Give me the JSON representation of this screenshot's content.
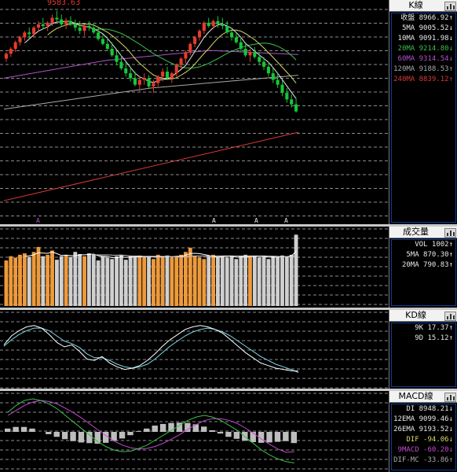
{
  "colors": {
    "up": "#e63b2e",
    "down": "#17c63a",
    "ma5": "#e8e8e8",
    "ma10": "#d8d86a",
    "ma20": "#3bbf4c",
    "ma60": "#b153c8",
    "ma120": "#a9a9a9",
    "ma240": "#d43a3a",
    "vol_up": "#ee9a3c",
    "vol_down": "#d0d0d0",
    "k": "#ffffff",
    "d": "#80d8e8",
    "grid": "#8c8c8c",
    "panel_bg": "#000000"
  },
  "kline": {
    "title": "K線",
    "high_label": "9583.63",
    "rows": [
      {
        "label": "收盤",
        "value": "8966.92",
        "arrow": "↑",
        "color": "#e8e8e8"
      },
      {
        "label": "5MA",
        "value": "9005.52",
        "arrow": "↓",
        "color": "#e8e8e8"
      },
      {
        "label": "10MA",
        "value": "9091.98",
        "arrow": "↓",
        "color": "#e8e8e8"
      },
      {
        "label": "20MA",
        "value": "9214.80",
        "arrow": "↓",
        "color": "#3bbf4c"
      },
      {
        "label": "60MA",
        "value": "9314.54",
        "arrow": "↓",
        "color": "#b153c8"
      },
      {
        "label": "120MA",
        "value": "9188.53",
        "arrow": "↑",
        "color": "#a9a9a9"
      },
      {
        "label": "240MA",
        "value": "8839.12",
        "arrow": "↑",
        "color": "#d43a3a"
      }
    ],
    "markers": [
      "A",
      "A",
      "A",
      "A"
    ]
  },
  "volume": {
    "title": "成交量",
    "rows": [
      {
        "label": "VOL",
        "value": "1002",
        "arrow": "↑",
        "color": "#e8e8e8"
      },
      {
        "label": "5MA",
        "value": "870.30",
        "arrow": "↑",
        "color": "#e8e8e8"
      },
      {
        "label": "20MA",
        "value": "790.83",
        "arrow": "↑",
        "color": "#e8e8e8"
      }
    ]
  },
  "kd": {
    "title": "KD線",
    "rows": [
      {
        "label": "9K",
        "value": "17.37",
        "arrow": "↑",
        "color": "#e8e8e8"
      },
      {
        "label": "9D",
        "value": "15.12",
        "arrow": "↑",
        "color": "#e8e8e8"
      }
    ]
  },
  "macd": {
    "title": "MACD線",
    "rows": [
      {
        "label": "DI",
        "value": "8948.21",
        "arrow": "↓",
        "color": "#e8e8e8"
      },
      {
        "label": "12EMA",
        "value": "9099.46",
        "arrow": "↓",
        "color": "#e8e8e8"
      },
      {
        "label": "26EMA",
        "value": "9193.52",
        "arrow": "↓",
        "color": "#e8e8e8"
      },
      {
        "label": "DIF",
        "value": "-94.06",
        "arrow": "↓",
        "color": "#d8d86a"
      },
      {
        "label": "9MACD",
        "value": "-60.20",
        "arrow": "↓",
        "color": "#c24ad2"
      },
      {
        "label": "DIF-MC",
        "value": "-33.86",
        "arrow": "↑",
        "color": "#a9a9a9"
      }
    ]
  },
  "chart_data": [
    {
      "type": "candlestick",
      "title": "K線",
      "candles": [
        [
          9290,
          9330,
          9270,
          9320
        ],
        [
          9320,
          9360,
          9300,
          9350
        ],
        [
          9350,
          9400,
          9330,
          9390
        ],
        [
          9390,
          9430,
          9370,
          9420
        ],
        [
          9420,
          9460,
          9400,
          9450
        ],
        [
          9450,
          9480,
          9410,
          9440
        ],
        [
          9440,
          9490,
          9420,
          9480
        ],
        [
          9480,
          9520,
          9460,
          9500
        ],
        [
          9500,
          9540,
          9470,
          9490
        ],
        [
          9490,
          9520,
          9460,
          9510
        ],
        [
          9510,
          9560,
          9490,
          9540
        ],
        [
          9540,
          9583.63,
          9510,
          9530
        ],
        [
          9530,
          9560,
          9490,
          9500
        ],
        [
          9500,
          9540,
          9470,
          9520
        ],
        [
          9520,
          9550,
          9490,
          9500
        ],
        [
          9500,
          9530,
          9460,
          9480
        ],
        [
          9480,
          9520,
          9440,
          9460
        ],
        [
          9460,
          9500,
          9430,
          9490
        ],
        [
          9490,
          9520,
          9460,
          9480
        ],
        [
          9480,
          9510,
          9440,
          9450
        ],
        [
          9450,
          9480,
          9400,
          9410
        ],
        [
          9410,
          9440,
          9370,
          9380
        ],
        [
          9380,
          9420,
          9340,
          9350
        ],
        [
          9350,
          9390,
          9300,
          9310
        ],
        [
          9310,
          9340,
          9250,
          9270
        ],
        [
          9270,
          9310,
          9220,
          9230
        ],
        [
          9230,
          9270,
          9180,
          9200
        ],
        [
          9200,
          9240,
          9150,
          9170
        ],
        [
          9170,
          9210,
          9120,
          9130
        ],
        [
          9130,
          9180,
          9090,
          9160
        ],
        [
          9160,
          9200,
          9130,
          9170
        ],
        [
          9170,
          9190,
          9110,
          9120
        ],
        [
          9120,
          9160,
          9080,
          9140
        ],
        [
          9140,
          9190,
          9120,
          9180
        ],
        [
          9180,
          9230,
          9150,
          9210
        ],
        [
          9210,
          9240,
          9160,
          9170
        ],
        [
          9170,
          9210,
          9140,
          9200
        ],
        [
          9200,
          9260,
          9180,
          9250
        ],
        [
          9250,
          9300,
          9230,
          9290
        ],
        [
          9290,
          9340,
          9260,
          9330
        ],
        [
          9330,
          9390,
          9310,
          9380
        ],
        [
          9380,
          9430,
          9360,
          9420
        ],
        [
          9420,
          9470,
          9400,
          9460
        ],
        [
          9460,
          9520,
          9440,
          9510
        ],
        [
          9510,
          9540,
          9480,
          9490
        ],
        [
          9490,
          9530,
          9470,
          9520
        ],
        [
          9520,
          9550,
          9480,
          9500
        ],
        [
          9500,
          9540,
          9470,
          9490
        ],
        [
          9490,
          9520,
          9440,
          9450
        ],
        [
          9450,
          9480,
          9400,
          9420
        ],
        [
          9420,
          9450,
          9380,
          9390
        ],
        [
          9390,
          9420,
          9330,
          9350
        ],
        [
          9350,
          9380,
          9300,
          9310
        ],
        [
          9310,
          9350,
          9270,
          9330
        ],
        [
          9330,
          9360,
          9290,
          9300
        ],
        [
          9300,
          9330,
          9250,
          9270
        ],
        [
          9270,
          9300,
          9220,
          9240
        ],
        [
          9240,
          9270,
          9180,
          9200
        ],
        [
          9200,
          9230,
          9140,
          9160
        ],
        [
          9160,
          9200,
          9110,
          9130
        ],
        [
          9130,
          9160,
          9060,
          9080
        ],
        [
          9080,
          9110,
          9020,
          9040
        ],
        [
          9040,
          9070,
          8990,
          9010
        ],
        [
          9010,
          9050,
          8960,
          8966.92
        ]
      ]
    },
    {
      "type": "bar",
      "title": "成交量",
      "values": [
        640,
        700,
        680,
        720,
        740,
        690,
        760,
        830,
        700,
        720,
        780,
        650,
        700,
        720,
        690,
        760,
        730,
        700,
        740,
        720,
        640,
        700,
        680,
        660,
        700,
        720,
        650,
        700,
        690,
        710,
        680,
        700,
        660,
        720,
        690,
        710,
        680,
        700,
        720,
        760,
        820,
        700,
        680,
        660,
        700,
        720,
        690,
        700,
        680,
        700,
        660,
        700,
        720,
        690,
        700,
        680,
        700,
        660,
        700,
        690,
        710,
        700,
        720,
        1002
      ]
    },
    {
      "type": "line",
      "title": "KD線",
      "series": [
        {
          "name": "9K",
          "values": [
            58,
            72,
            80,
            86,
            88,
            84,
            74,
            62,
            55,
            58,
            48,
            36,
            34,
            40,
            30,
            24,
            20,
            22,
            26,
            34,
            44,
            56,
            66,
            74,
            82,
            86,
            88,
            86,
            82,
            76,
            66,
            56,
            46,
            38,
            30,
            26,
            22,
            20,
            18,
            17.37
          ]
        },
        {
          "name": "9D",
          "values": [
            56,
            66,
            74,
            80,
            84,
            84,
            80,
            72,
            64,
            60,
            54,
            44,
            38,
            38,
            34,
            28,
            24,
            22,
            24,
            28,
            36,
            46,
            56,
            64,
            72,
            78,
            82,
            84,
            82,
            78,
            72,
            64,
            56,
            48,
            40,
            34,
            28,
            24,
            20,
            15.12
          ]
        }
      ]
    },
    {
      "type": "bar",
      "title": "MACD線",
      "series": [
        {
          "name": "DIF",
          "values": [
            60,
            80,
            95,
            100,
            95,
            85,
            70,
            50,
            30,
            10,
            -10,
            -30,
            -45,
            -55,
            -60,
            -58,
            -50,
            -40,
            -25,
            -10,
            5,
            20,
            35,
            45,
            50,
            45,
            35,
            20,
            5,
            -15,
            -35,
            -55,
            -70,
            -82,
            -90,
            -94.06
          ]
        },
        {
          "name": "9MACD",
          "values": [
            50,
            65,
            80,
            90,
            95,
            92,
            85,
            72,
            58,
            42,
            24,
            6,
            -12,
            -28,
            -40,
            -48,
            -52,
            -50,
            -44,
            -34,
            -22,
            -8,
            8,
            22,
            34,
            40,
            40,
            35,
            26,
            12,
            -4,
            -22,
            -38,
            -52,
            -62,
            -60.2
          ]
        },
        {
          "name": "DIF-MC",
          "values": [
            10,
            15,
            15,
            10,
            0,
            -7,
            -15,
            -22,
            -28,
            -32,
            -34,
            -36,
            -33,
            -27,
            -20,
            -10,
            2,
            10,
            19,
            24,
            27,
            28,
            27,
            23,
            16,
            5,
            -5,
            -15,
            -21,
            -27,
            -31,
            -33,
            -32,
            -30,
            -28,
            -33.86
          ]
        }
      ]
    }
  ]
}
